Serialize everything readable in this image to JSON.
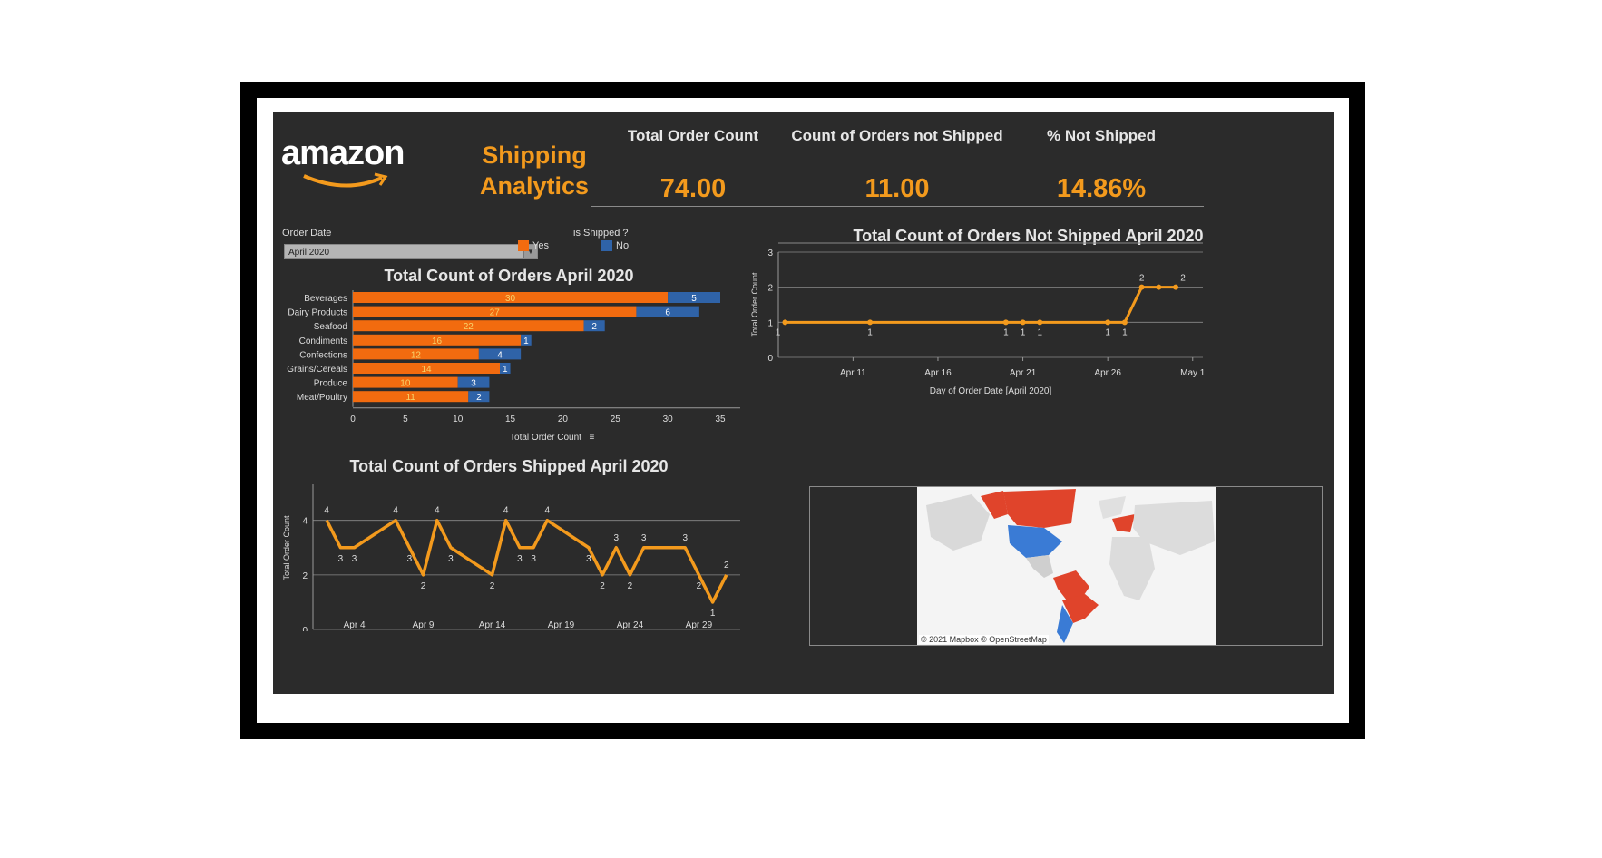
{
  "header": {
    "logo_text": "amazon",
    "title": "Shipping Analytics"
  },
  "kpis": [
    {
      "label": "Total Order Count",
      "value": "74.00"
    },
    {
      "label": "Count of Orders not Shipped",
      "value": "11.00"
    },
    {
      "label": "% Not Shipped",
      "value": "14.86%"
    }
  ],
  "filters": {
    "order_date_label": "Order Date",
    "order_date_value": "April 2020",
    "legend_title": "is Shipped ?",
    "legend_items": [
      {
        "label": "Yes",
        "color": "#f26b0f"
      },
      {
        "label": "No",
        "color": "#2f63a8"
      }
    ]
  },
  "map": {
    "attribution": "© 2021 Mapbox © OpenStreetMap"
  },
  "chart_data": [
    {
      "type": "bar",
      "title": "Total Count of Orders April 2020",
      "xlabel": "Total Order Count",
      "xlim": [
        0,
        35
      ],
      "ticks": [
        0,
        5,
        10,
        15,
        20,
        25,
        30,
        35
      ],
      "categories": [
        "Beverages",
        "Dairy Products",
        "Seafood",
        "Condiments",
        "Confections",
        "Grains/Cereals",
        "Produce",
        "Meat/Poultry"
      ],
      "series": [
        {
          "name": "Yes",
          "values": [
            30,
            27,
            22,
            16,
            12,
            14,
            10,
            11
          ],
          "color": "#f26b0f"
        },
        {
          "name": "No",
          "values": [
            5,
            6,
            2,
            1,
            4,
            1,
            3,
            2
          ],
          "color": "#2f63a8"
        }
      ],
      "stacked": true
    },
    {
      "type": "line",
      "title": "Total Count of Orders Not Shipped April 2020",
      "xlabel": "Day of Order Date [April 2020]",
      "ylabel": "Total Order Count",
      "ylim": [
        0,
        3
      ],
      "yticks": [
        0,
        1,
        2,
        3
      ],
      "xticks": [
        "Apr 11",
        "Apr 16",
        "Apr 21",
        "Apr 26",
        "May 1"
      ],
      "x": [
        "2020-04-07",
        "2020-04-12",
        "2020-04-20",
        "2020-04-21",
        "2020-04-22",
        "2020-04-26",
        "2020-04-27",
        "2020-04-28",
        "2020-04-29",
        "2020-04-30"
      ],
      "y": [
        1,
        1,
        1,
        1,
        1,
        1,
        1,
        2,
        2,
        2
      ],
      "labels": [
        "1",
        "1",
        "1",
        "1",
        "1",
        "1",
        "1",
        "2",
        "",
        "2"
      ],
      "color": "#f39a1d"
    },
    {
      "type": "line",
      "title": "Total Count of Orders Shipped April 2020",
      "ylabel": "Total Order Count",
      "ylim": [
        0,
        5
      ],
      "yticks": [
        0,
        2,
        4
      ],
      "xticks": [
        "Apr 4",
        "Apr 9",
        "Apr 14",
        "Apr 19",
        "Apr 24",
        "Apr 29"
      ],
      "x": [
        "2020-04-02",
        "2020-04-03",
        "2020-04-04",
        "2020-04-07",
        "2020-04-08",
        "2020-04-09",
        "2020-04-10",
        "2020-04-11",
        "2020-04-14",
        "2020-04-15",
        "2020-04-16",
        "2020-04-17",
        "2020-04-18",
        "2020-04-21",
        "2020-04-22",
        "2020-04-23",
        "2020-04-24",
        "2020-04-25",
        "2020-04-28",
        "2020-04-29",
        "2020-04-30",
        "2020-05-01"
      ],
      "y": [
        4,
        3,
        3,
        4,
        3,
        2,
        4,
        3,
        2,
        4,
        3,
        3,
        4,
        3,
        2,
        3,
        2,
        3,
        3,
        2,
        1,
        2
      ],
      "color": "#f39a1d"
    }
  ]
}
